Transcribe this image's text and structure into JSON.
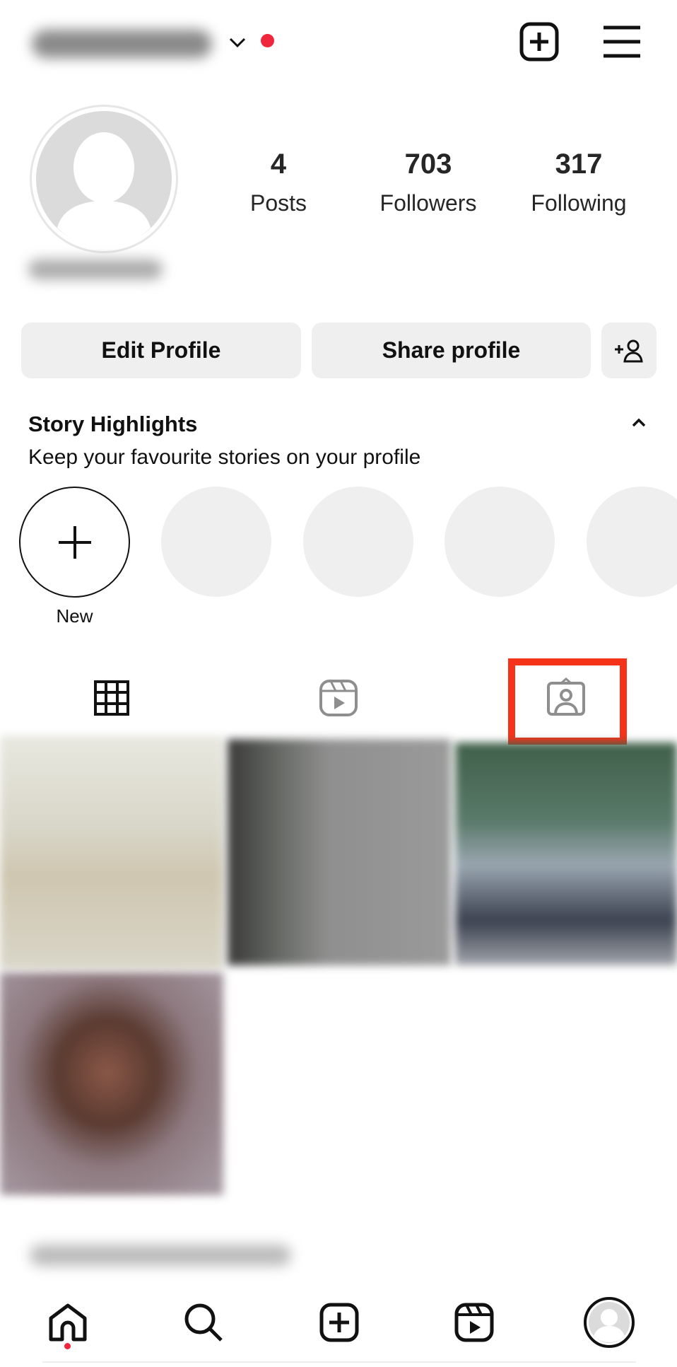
{
  "stats": [
    {
      "value": "4",
      "label": "Posts"
    },
    {
      "value": "703",
      "label": "Followers"
    },
    {
      "value": "317",
      "label": "Following"
    }
  ],
  "buttons": {
    "edit": "Edit Profile",
    "share": "Share profile"
  },
  "highlights": {
    "title": "Story Highlights",
    "subtitle": "Keep your favourite stories on your profile",
    "new_label": "New"
  },
  "tabs": {
    "active": "posts-grid",
    "highlighted": "tagged"
  },
  "colors": {
    "accent": "#f0263c",
    "highlight_box": "#f5331a",
    "button_bg": "#efefef"
  },
  "bottom_nav": [
    "home",
    "search",
    "create",
    "reels",
    "profile"
  ]
}
